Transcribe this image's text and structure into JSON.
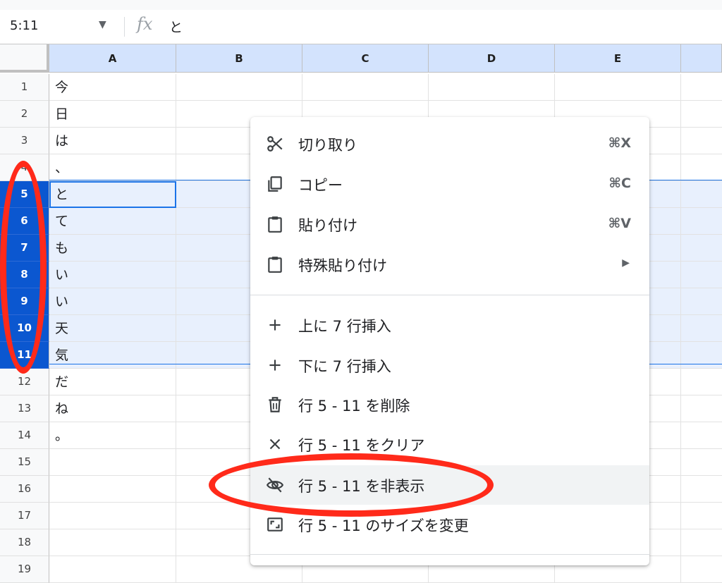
{
  "formula_bar": {
    "name_box": "5:11",
    "fx_label": "fx",
    "content": "と"
  },
  "columns": [
    "A",
    "B",
    "C",
    "D",
    "E"
  ],
  "rows": [
    {
      "num": "1",
      "a": "今"
    },
    {
      "num": "2",
      "a": "日"
    },
    {
      "num": "3",
      "a": "は"
    },
    {
      "num": "4",
      "a": "、"
    },
    {
      "num": "5",
      "a": "と"
    },
    {
      "num": "6",
      "a": "て"
    },
    {
      "num": "7",
      "a": "も"
    },
    {
      "num": "8",
      "a": "い"
    },
    {
      "num": "9",
      "a": "い"
    },
    {
      "num": "10",
      "a": "天"
    },
    {
      "num": "11",
      "a": "気"
    },
    {
      "num": "12",
      "a": "だ"
    },
    {
      "num": "13",
      "a": "ね"
    },
    {
      "num": "14",
      "a": "。"
    },
    {
      "num": "15",
      "a": ""
    },
    {
      "num": "16",
      "a": ""
    },
    {
      "num": "17",
      "a": ""
    },
    {
      "num": "18",
      "a": ""
    },
    {
      "num": "19",
      "a": ""
    }
  ],
  "context_menu": {
    "cut": {
      "label": "切り取り",
      "shortcut": "⌘X",
      "icon": "scissors-icon"
    },
    "copy": {
      "label": "コピー",
      "shortcut": "⌘C",
      "icon": "copy-icon"
    },
    "paste": {
      "label": "貼り付け",
      "shortcut": "⌘V",
      "icon": "clipboard-icon"
    },
    "paste_special": {
      "label": "特殊貼り付け",
      "arrow": "▶",
      "icon": "clipboard-icon"
    },
    "insert_above": {
      "label": "上に 7 行挿入",
      "icon": "plus-icon"
    },
    "insert_below": {
      "label": "下に 7 行挿入",
      "icon": "plus-icon"
    },
    "delete_rows": {
      "label": "行 5 - 11 を削除",
      "icon": "trash-icon"
    },
    "clear_rows": {
      "label": "行 5 - 11 をクリア",
      "icon": "close-icon"
    },
    "hide_rows": {
      "label": "行 5 - 11 を非表示",
      "icon": "eye-off-icon"
    },
    "resize_rows": {
      "label": "行 5 - 11 のサイズを変更",
      "icon": "resize-icon"
    }
  },
  "colors": {
    "accent": "#0b57d0",
    "annotation": "#ff2a1a",
    "selection": "#e8f0fd"
  }
}
